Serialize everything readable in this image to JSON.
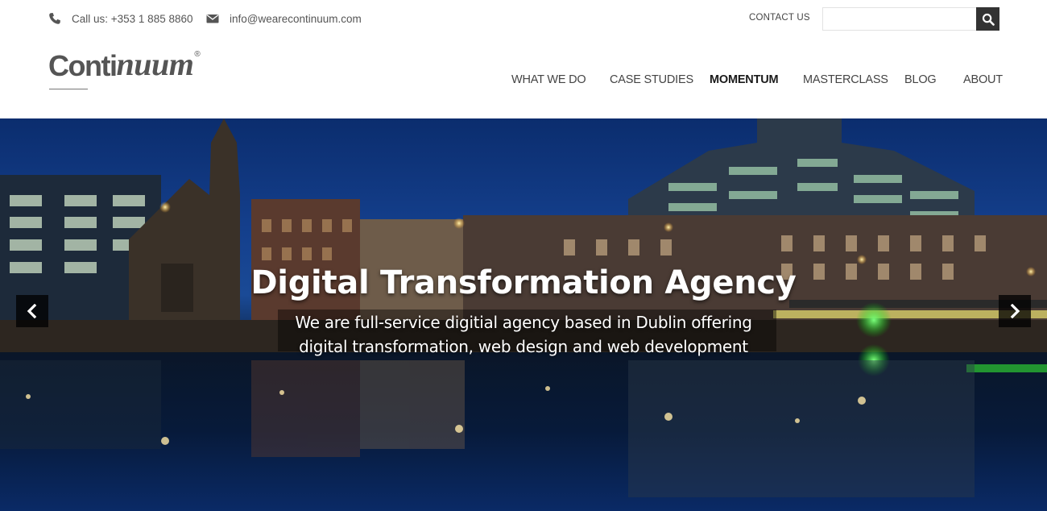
{
  "topbar": {
    "phone_text": "Call us: +353 1 885 8860",
    "email_text": "info@wearecontinuum.com",
    "contact_link": "CONTACT US",
    "search_placeholder": "",
    "search_value": ""
  },
  "logo": {
    "main": "Conti",
    "italic": "nuum",
    "reg": "®"
  },
  "nav": {
    "items": [
      {
        "label": "WHAT WE DO"
      },
      {
        "label": "CASE STUDIES"
      },
      {
        "label": "MOMENTUM"
      },
      {
        "label": "MASTERCLASS"
      },
      {
        "label": "BLOG"
      },
      {
        "label": "ABOUT"
      }
    ]
  },
  "hero": {
    "title": "Digital Transformation Agency",
    "subtitle_line1": "We are full-service digitial agency based in Dublin offering",
    "subtitle_line2": "digital transformation, web design and web development"
  },
  "icons": {
    "phone": "phone-icon",
    "email": "envelope-icon",
    "search": "search-icon",
    "prev": "chevron-left-icon",
    "next": "chevron-right-icon"
  },
  "colors": {
    "header_bg": "#ffffff",
    "search_button_bg": "#333333",
    "text": "#444444",
    "sky": "#143f8c",
    "water": "#020814"
  }
}
